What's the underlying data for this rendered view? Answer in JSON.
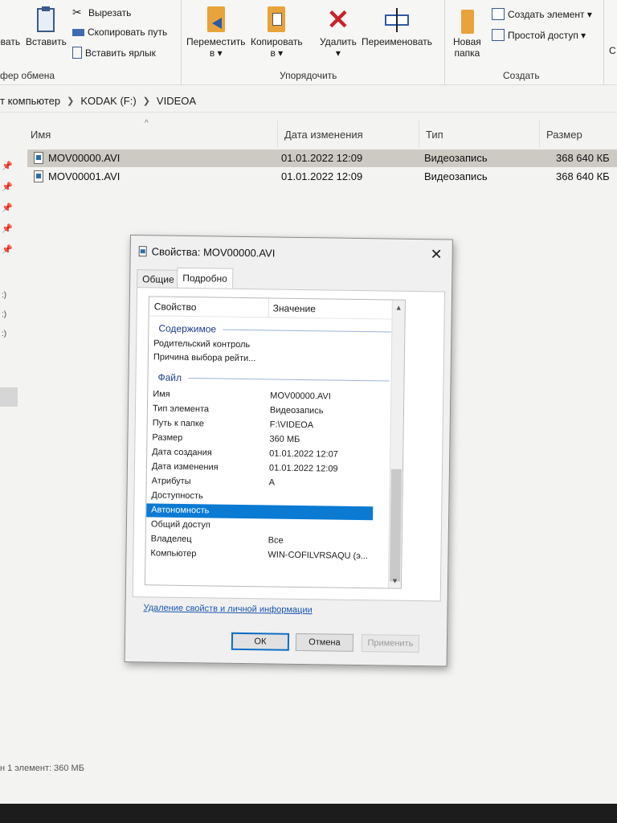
{
  "ribbon": {
    "clipboard": {
      "group_label": "фер обмена",
      "copy_path": "овать",
      "paste": "Вставить",
      "cut": "Вырезать",
      "copy_path_label": "Скопировать путь",
      "paste_shortcut": "Вставить ярлык"
    },
    "organize": {
      "group_label": "Упорядочить",
      "move_to": "Переместить",
      "move_to_sub": "в ▾",
      "copy_to": "Копировать",
      "copy_to_sub": "в ▾",
      "delete": "Удалить",
      "delete_sub": "▾",
      "rename": "Переименовать"
    },
    "create": {
      "group_label": "Создать",
      "new_folder_line1": "Новая",
      "new_folder_line2": "папка",
      "new_item": "Создать элемент ▾",
      "easy_access": "Простой доступ ▾"
    },
    "open_edge": "С"
  },
  "address": {
    "parts": [
      "т компьютер",
      "KODAK (F:)",
      "VIDEOA"
    ]
  },
  "columns": {
    "name": "Имя",
    "date": "Дата изменения",
    "type": "Тип",
    "size": "Размер"
  },
  "files": [
    {
      "name": "MOV00000.AVI",
      "date": "01.01.2022 12:09",
      "type": "Видеозапись",
      "size": "368 640 КБ"
    },
    {
      "name": "MOV00001.AVI",
      "date": "01.01.2022 12:09",
      "type": "Видеозапись",
      "size": "368 640 КБ"
    }
  ],
  "leftpane": {
    "drives": [
      ":)",
      ":)",
      ":)"
    ]
  },
  "status": "н 1 элемент: 360 МБ",
  "dialog": {
    "title": "Свойства: MOV00000.AVI",
    "tabs": [
      "Общие",
      "Подробно"
    ],
    "header": {
      "property": "Свойство",
      "value": "Значение"
    },
    "group_content": "Содержимое",
    "group_file": "Файл",
    "content_rows": [
      {
        "name": "Родительский контроль",
        "value": ""
      },
      {
        "name": "Причина выбора рейти...",
        "value": ""
      }
    ],
    "file_rows": [
      {
        "name": "Имя",
        "value": "MOV00000.AVI"
      },
      {
        "name": "Тип элемента",
        "value": "Видеозапись"
      },
      {
        "name": "Путь к папке",
        "value": "F:\\VIDEOA"
      },
      {
        "name": "Размер",
        "value": "360 МБ"
      },
      {
        "name": "Дата создания",
        "value": "01.01.2022 12:07"
      },
      {
        "name": "Дата изменения",
        "value": "01.01.2022 12:09"
      },
      {
        "name": "Атрибуты",
        "value": "A"
      },
      {
        "name": "Доступность",
        "value": ""
      },
      {
        "name": "Автономность",
        "value": ""
      },
      {
        "name": "Общий доступ",
        "value": ""
      },
      {
        "name": "Владелец",
        "value": "Все"
      },
      {
        "name": "Компьютер",
        "value": "WIN-COFILVRSAQU (э..."
      }
    ],
    "link": "Удаление свойств и личной информации",
    "buttons": {
      "ok": "ОК",
      "cancel": "Отмена",
      "apply": "Применить"
    }
  }
}
